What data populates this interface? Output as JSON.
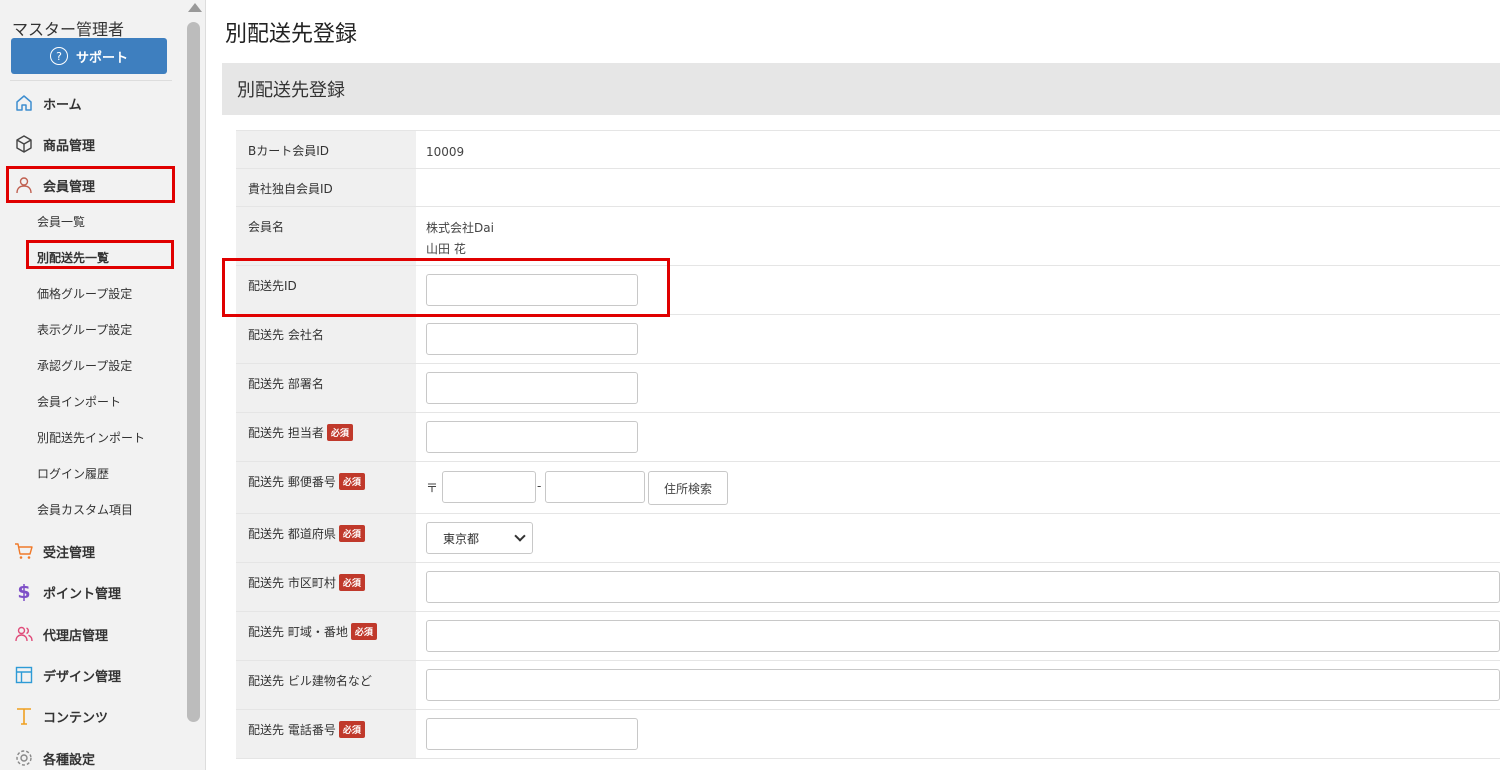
{
  "sidebar": {
    "user_name": "マスター管理者",
    "support_label": "サポート",
    "nav": {
      "home": "ホーム",
      "products": "商品管理",
      "members": "会員管理",
      "orders": "受注管理",
      "points": "ポイント管理",
      "agencies": "代理店管理",
      "design": "デザイン管理",
      "contents": "コンテンツ",
      "settings": "各種設定"
    },
    "sub_items": [
      "会員一覧",
      "別配送先一覧",
      "価格グループ設定",
      "表示グループ設定",
      "承認グループ設定",
      "会員インポート",
      "別配送先インポート",
      "ログイン履歴",
      "会員カスタム項目"
    ],
    "icon_colors": {
      "home": "#3e8ed0",
      "orders": "#f07a2a",
      "points": "#7e4fc7",
      "agencies": "#e04c7a",
      "design": "#2e9bd6",
      "contents": "#f0a020",
      "settings": "#888888"
    }
  },
  "page": {
    "title": "別配送先登録",
    "panel_title": "別配送先登録"
  },
  "form": {
    "required_badge": "必須",
    "bcart_id_label": "Bカート会員ID",
    "bcart_id_value": "10009",
    "own_id_label": "貴社独自会員ID",
    "member_name_label": "会員名",
    "member_company": "株式会社Dai",
    "member_person": "山田 花",
    "dest_id_label": "配送先ID",
    "company_label": "配送先 会社名",
    "department_label": "配送先 部署名",
    "person_label": "配送先 担当者",
    "zip_label": "配送先 郵便番号",
    "zip_mark": "〒",
    "zip_dash": "-",
    "address_search": "住所検索",
    "pref_label": "配送先 都道府県",
    "pref_value": "東京都",
    "city_label": "配送先 市区町村",
    "town_label": "配送先 町域・番地",
    "building_label": "配送先 ビル建物名など",
    "phone_label": "配送先 電話番号"
  }
}
